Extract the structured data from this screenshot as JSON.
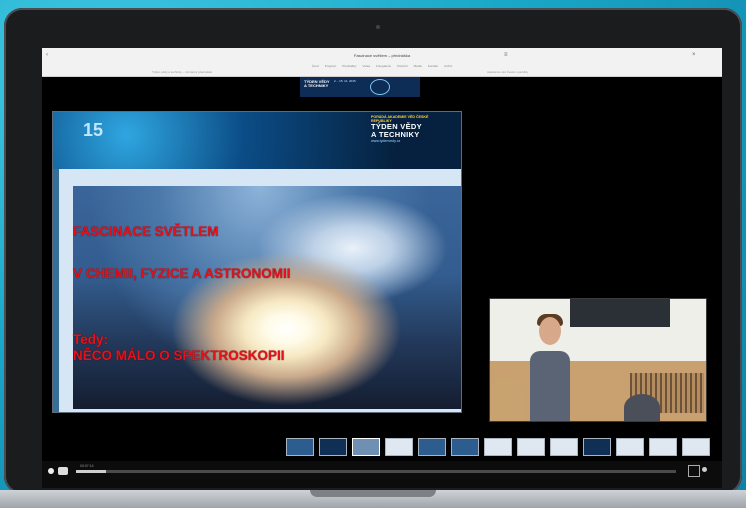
{
  "browser": {
    "tab_title": "Fascinace světlem – přednáška",
    "nav_items": [
      "Úvod",
      "Program",
      "Přednášky",
      "Videa",
      "Fotogalerie",
      "Partneři",
      "Média",
      "Kontakt",
      "Archiv"
    ],
    "sub_left": "Týden vědy a techniky – záznamy přednášek",
    "sub_right": "Akademie věd České republiky"
  },
  "site_header": {
    "title": "TÝDEN VĚDY A TECHNIKY",
    "dates": "2. - 15. 11. 2015"
  },
  "slide": {
    "banner_number": "15",
    "banner_small": "PORÁDÁ AKADEMIE VĚD ČESKÉ REPUBLIKY",
    "banner_title_1": "TÝDEN VĚDY",
    "banner_title_2": "A TECHNIKY",
    "banner_url": "www.tydenvedy.cz",
    "line1": "FASCINACE SVĚTLEM",
    "line2": "V CHEMII, FYZICE A   ASTRONOMII",
    "line3": "Tedy:",
    "line4": "NĚCO MÁLO O SPEKTROSKOPII"
  },
  "thumbnails": {
    "count": 13,
    "active_index": 2
  },
  "player": {
    "time": "00:07:14",
    "progress": 0.05
  }
}
